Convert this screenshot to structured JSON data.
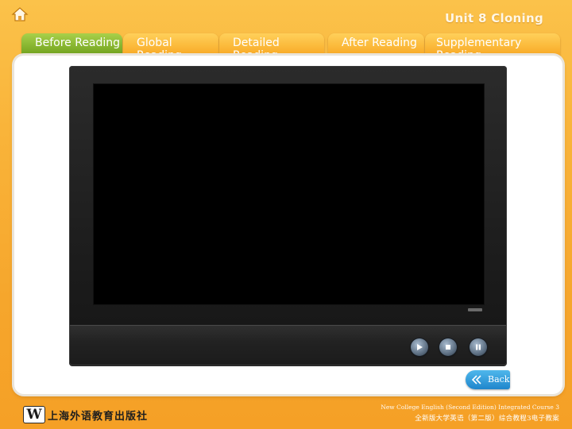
{
  "header": {
    "unit_title": "Unit 8 Cloning"
  },
  "nav": {
    "home_icon": "home-icon",
    "tabs": [
      {
        "label": "Before Reading",
        "active": true
      },
      {
        "label": "Global Reading",
        "active": false
      },
      {
        "label": "Detailed Reading",
        "active": false
      },
      {
        "label": "After Reading",
        "active": false
      },
      {
        "label": "Supplementary Reading",
        "active": false
      }
    ]
  },
  "player": {
    "controls": [
      {
        "name": "play",
        "icon": "play-icon"
      },
      {
        "name": "stop",
        "icon": "stop-icon"
      },
      {
        "name": "pause",
        "icon": "pause-icon"
      }
    ]
  },
  "back_button": {
    "label": "Back",
    "icon": "double-chevron-left-icon"
  },
  "publisher": {
    "logo_mark": "W",
    "name": "上海外语教育出版社"
  },
  "footer": {
    "line_en": "New College English (Second Edition) Integrated Course 3",
    "line_cn": "全新版大学英语（第二版）综合教程3电子教案"
  },
  "colors": {
    "background": "#f9b43a",
    "tab": "#f8a621",
    "tab_active": "#6c9e1a",
    "back_button": "#1f86cc",
    "screen": "#000000"
  }
}
